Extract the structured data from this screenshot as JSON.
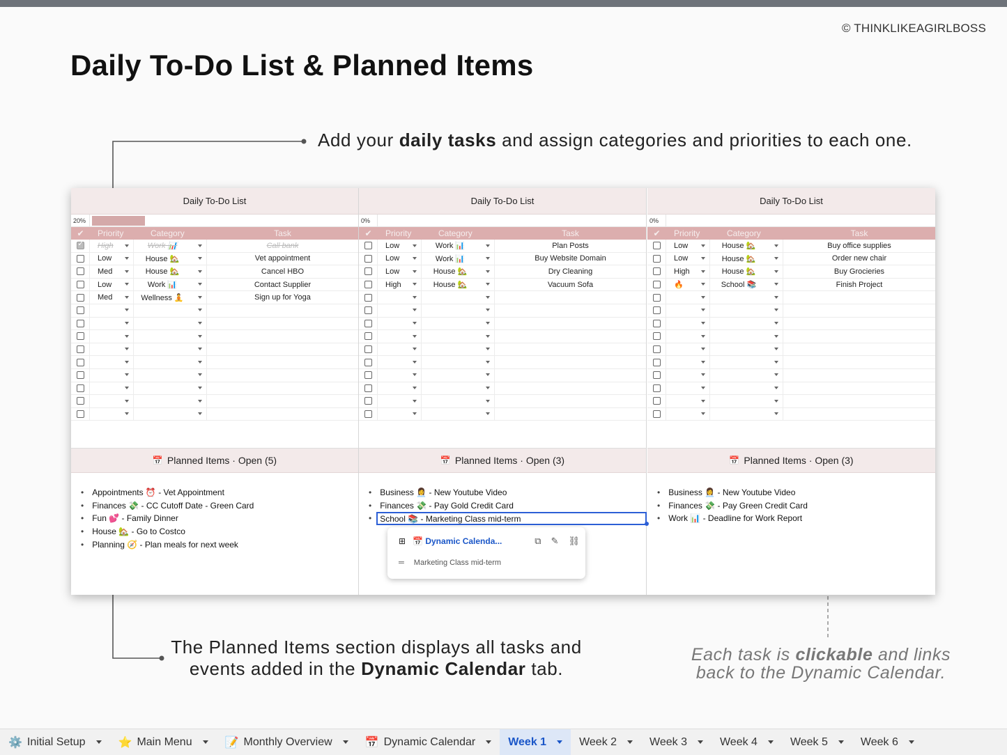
{
  "header": {
    "copyright": "© THINKLIKEAGIRLBOSS",
    "title": "Daily To-Do List & Planned Items"
  },
  "callouts": {
    "top_pre": "Add your ",
    "top_bold": "daily tasks",
    "top_post": " and assign categories and priorities to each one.",
    "bottom_line1": "The Planned Items section displays all tasks and",
    "bottom_line2_pre": "events added in the ",
    "bottom_line2_bold": "Dynamic Calendar",
    "bottom_line2_post": " tab.",
    "right_pre": "Each task is ",
    "right_bold": "clickable",
    "right_post": " and links back to the Dynamic Calendar."
  },
  "panels": [
    {
      "title": "Daily To-Do List",
      "progress_label": "20%",
      "progress": 0.2,
      "headers": {
        "check": "✔",
        "priority": "Priority",
        "category": "Category",
        "task": "Task"
      },
      "rows": [
        {
          "checked": true,
          "priority": "High",
          "category": "Work 📊",
          "task": "Call bank"
        },
        {
          "checked": false,
          "priority": "Low",
          "category": "House 🏡",
          "task": "Vet appointment"
        },
        {
          "checked": false,
          "priority": "Med",
          "category": "House 🏡",
          "task": "Cancel HBO"
        },
        {
          "checked": false,
          "priority": "Low",
          "category": "Work 📊",
          "task": "Contact Supplier"
        },
        {
          "checked": false,
          "priority": "Med",
          "category": "Wellness 🧘",
          "task": "Sign up for Yoga"
        },
        {
          "checked": false,
          "priority": "",
          "category": "",
          "task": ""
        },
        {
          "checked": false,
          "priority": "",
          "category": "",
          "task": ""
        },
        {
          "checked": false,
          "priority": "",
          "category": "",
          "task": ""
        },
        {
          "checked": false,
          "priority": "",
          "category": "",
          "task": ""
        },
        {
          "checked": false,
          "priority": "",
          "category": "",
          "task": ""
        },
        {
          "checked": false,
          "priority": "",
          "category": "",
          "task": ""
        },
        {
          "checked": false,
          "priority": "",
          "category": "",
          "task": ""
        },
        {
          "checked": false,
          "priority": "",
          "category": "",
          "task": ""
        },
        {
          "checked": false,
          "priority": "",
          "category": "",
          "task": ""
        }
      ],
      "planned_title": "Planned Items · Open (5)",
      "planned": [
        "Appointments ⏰ - Vet Appointment",
        "Finances 💸 - CC Cutoff Date - Green Card",
        "Fun 💕 - Family Dinner",
        "House 🏡 - Go to Costco",
        "Planning 🧭 - Plan meals for next week"
      ]
    },
    {
      "title": "Daily To-Do List",
      "progress_label": "0%",
      "progress": 0,
      "headers": {
        "check": "✔",
        "priority": "Priority",
        "category": "Category",
        "task": "Task"
      },
      "rows": [
        {
          "checked": false,
          "priority": "Low",
          "category": "Work 📊",
          "task": "Plan Posts"
        },
        {
          "checked": false,
          "priority": "Low",
          "category": "Work 📊",
          "task": "Buy Website Domain"
        },
        {
          "checked": false,
          "priority": "Low",
          "category": "House 🏡",
          "task": "Dry Cleaning"
        },
        {
          "checked": false,
          "priority": "High",
          "category": "House 🏡",
          "task": "Vacuum Sofa"
        },
        {
          "checked": false,
          "priority": "",
          "category": "",
          "task": ""
        },
        {
          "checked": false,
          "priority": "",
          "category": "",
          "task": ""
        },
        {
          "checked": false,
          "priority": "",
          "category": "",
          "task": ""
        },
        {
          "checked": false,
          "priority": "",
          "category": "",
          "task": ""
        },
        {
          "checked": false,
          "priority": "",
          "category": "",
          "task": ""
        },
        {
          "checked": false,
          "priority": "",
          "category": "",
          "task": ""
        },
        {
          "checked": false,
          "priority": "",
          "category": "",
          "task": ""
        },
        {
          "checked": false,
          "priority": "",
          "category": "",
          "task": ""
        },
        {
          "checked": false,
          "priority": "",
          "category": "",
          "task": ""
        },
        {
          "checked": false,
          "priority": "",
          "category": "",
          "task": ""
        }
      ],
      "planned_title": "Planned Items · Open (3)",
      "planned": [
        "Business 👩‍💼 - New Youtube Video",
        "Finances 💸 - Pay Gold Credit Card",
        "School 📚 - Marketing Class mid-term"
      ]
    },
    {
      "title": "Daily To-Do List",
      "progress_label": "0%",
      "progress": 0,
      "headers": {
        "check": "✔",
        "priority": "Priority",
        "category": "Category",
        "task": "Task"
      },
      "rows": [
        {
          "checked": false,
          "priority": "Low",
          "category": "House 🏡",
          "task": "Buy office supplies"
        },
        {
          "checked": false,
          "priority": "Low",
          "category": "House 🏡",
          "task": "Order new chair"
        },
        {
          "checked": false,
          "priority": "High",
          "category": "House 🏡",
          "task": "Buy Grocieries"
        },
        {
          "checked": false,
          "priority": "🔥",
          "category": "School 📚",
          "task": "Finish Project"
        },
        {
          "checked": false,
          "priority": "",
          "category": "",
          "task": ""
        },
        {
          "checked": false,
          "priority": "",
          "category": "",
          "task": ""
        },
        {
          "checked": false,
          "priority": "",
          "category": "",
          "task": ""
        },
        {
          "checked": false,
          "priority": "",
          "category": "",
          "task": ""
        },
        {
          "checked": false,
          "priority": "",
          "category": "",
          "task": ""
        },
        {
          "checked": false,
          "priority": "",
          "category": "",
          "task": ""
        },
        {
          "checked": false,
          "priority": "",
          "category": "",
          "task": ""
        },
        {
          "checked": false,
          "priority": "",
          "category": "",
          "task": ""
        },
        {
          "checked": false,
          "priority": "",
          "category": "",
          "task": ""
        },
        {
          "checked": false,
          "priority": "",
          "category": "",
          "task": ""
        }
      ],
      "planned_title": "Planned Items · Open (3)",
      "planned": [
        "Business 👩‍💼 - New Youtube Video",
        "Finances 💸 - Pay Green Credit Card",
        "Work 📊 - Deadline for Work Report"
      ]
    }
  ],
  "popup": {
    "link_text": "Dynamic Calenda...",
    "event_text": "Marketing Class mid-term",
    "icons": [
      "sheet-grid-icon",
      "calendar-icon",
      "copy-icon",
      "edit-icon",
      "unlink-icon",
      "notes-icon"
    ]
  },
  "tabs": [
    {
      "label": "Initial Setup",
      "icon": "⚙️",
      "active": false
    },
    {
      "label": "Main Menu",
      "icon": "⭐",
      "active": false
    },
    {
      "label": "Monthly Overview",
      "icon": "📝",
      "active": false
    },
    {
      "label": "Dynamic Calendar",
      "icon": "📅",
      "active": false
    },
    {
      "label": "Week 1",
      "icon": "",
      "active": true
    },
    {
      "label": "Week 2",
      "icon": "",
      "active": false
    },
    {
      "label": "Week 3",
      "icon": "",
      "active": false
    },
    {
      "label": "Week 4",
      "icon": "",
      "active": false
    },
    {
      "label": "Week 5",
      "icon": "",
      "active": false
    },
    {
      "label": "Week 6",
      "icon": "",
      "active": false
    }
  ],
  "colors": {
    "accent": "#dcaeae",
    "header_bg": "#f3eaea",
    "active_tab": "#1a56c8",
    "selection": "#2c5fd6"
  }
}
